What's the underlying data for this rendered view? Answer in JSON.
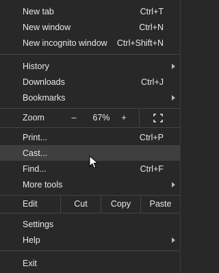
{
  "menu": {
    "new_tab": {
      "label": "New tab",
      "shortcut": "Ctrl+T"
    },
    "new_window": {
      "label": "New window",
      "shortcut": "Ctrl+N"
    },
    "new_incognito": {
      "label": "New incognito window",
      "shortcut": "Ctrl+Shift+N"
    },
    "history": {
      "label": "History"
    },
    "downloads": {
      "label": "Downloads",
      "shortcut": "Ctrl+J"
    },
    "bookmarks": {
      "label": "Bookmarks"
    },
    "zoom": {
      "label": "Zoom",
      "minus": "–",
      "level": "67%",
      "plus": "+"
    },
    "print": {
      "label": "Print...",
      "shortcut": "Ctrl+P"
    },
    "cast": {
      "label": "Cast..."
    },
    "find": {
      "label": "Find...",
      "shortcut": "Ctrl+F"
    },
    "more_tools": {
      "label": "More tools"
    },
    "edit": {
      "label": "Edit",
      "cut": "Cut",
      "copy": "Copy",
      "paste": "Paste"
    },
    "settings": {
      "label": "Settings"
    },
    "help": {
      "label": "Help"
    },
    "exit": {
      "label": "Exit"
    }
  },
  "icons": {
    "submenu": "chevron-right-icon",
    "fullscreen": "fullscreen-icon",
    "cursor": "mouse-pointer-icon"
  },
  "colors": {
    "background": "#282828",
    "hover": "#3f3f3f",
    "separator": "#444444",
    "text": "#e8e8e8"
  }
}
